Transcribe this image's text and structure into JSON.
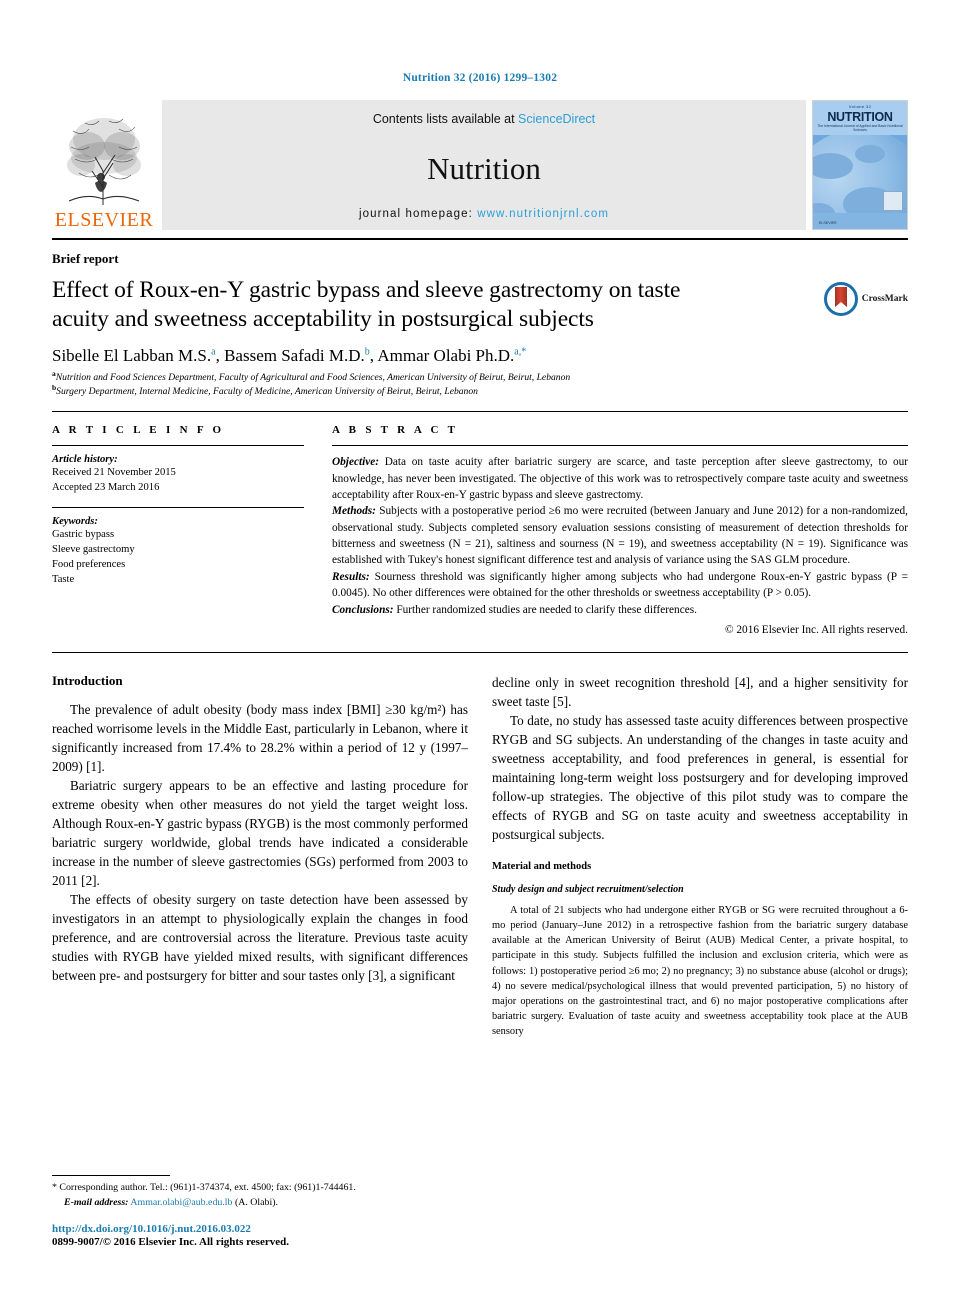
{
  "running_head": "Nutrition 32 (2016) 1299–1302",
  "masthead": {
    "contents_prefix": "Contents lists available at ",
    "sciencedirect": "ScienceDirect",
    "journal_name": "Nutrition",
    "homepage_prefix": "journal homepage: ",
    "homepage_url": "www.nutritionjrnl.com",
    "publisher": "ELSEVIER",
    "cover": {
      "volume_line": "Volume 32",
      "title": "NUTRITION",
      "subtitle": "The International Journal of Applied and Basic Nutritional Sciences",
      "publisher": "ELSEVIER"
    }
  },
  "article": {
    "kind": "Brief report",
    "title": "Effect of Roux-en-Y gastric bypass and sleeve gastrectomy on taste acuity and sweetness acceptability in postsurgical subjects",
    "crossmark_label": "CrossMark",
    "authors": [
      {
        "name": "Sibelle El Labban M.S.",
        "marks": "a",
        "sep": ", "
      },
      {
        "name": "Bassem Safadi M.D.",
        "marks": "b",
        "sep": ", "
      },
      {
        "name": "Ammar Olabi Ph.D.",
        "marks": "a,*",
        "sep": ""
      }
    ],
    "affiliations": [
      {
        "mark": "a",
        "text": "Nutrition and Food Sciences Department, Faculty of Agricultural and Food Sciences, American University of Beirut, Beirut, Lebanon"
      },
      {
        "mark": "b",
        "text": "Surgery Department, Internal Medicine, Faculty of Medicine, American University of Beirut, Beirut, Lebanon"
      }
    ]
  },
  "article_info": {
    "heading": "A R T I C L E  I N F O",
    "history_label": "Article history:",
    "history": [
      "Received 21 November 2015",
      "Accepted 23 March 2016"
    ],
    "keywords_label": "Keywords:",
    "keywords": [
      "Gastric bypass",
      "Sleeve gastrectomy",
      "Food preferences",
      "Taste"
    ]
  },
  "abstract": {
    "heading": "A B S T R A C T",
    "sections": [
      {
        "lead": "Objective:",
        "text": " Data on taste acuity after bariatric surgery are scarce, and taste perception after sleeve gastrectomy, to our knowledge, has never been investigated. The objective of this work was to retrospectively compare taste acuity and sweetness acceptability after Roux-en-Y gastric bypass and sleeve gastrectomy."
      },
      {
        "lead": "Methods:",
        "text": " Subjects with a postoperative period ≥6 mo were recruited (between January and June 2012) for a non-randomized, observational study. Subjects completed sensory evaluation sessions consisting of measurement of detection thresholds for bitterness and sweetness (N = 21), saltiness and sourness (N = 19), and sweetness acceptability (N = 19). Significance was established with Tukey's honest significant difference test and analysis of variance using the SAS GLM procedure."
      },
      {
        "lead": "Results:",
        "text": " Sourness threshold was significantly higher among subjects who had undergone Roux-en-Y gastric bypass (P = 0.0045). No other differences were obtained for the other thresholds or sweetness acceptability (P > 0.05)."
      },
      {
        "lead": "Conclusions:",
        "text": " Further randomized studies are needed to clarify these differences."
      }
    ],
    "copyright": "© 2016 Elsevier Inc. All rights reserved."
  },
  "body": {
    "left": {
      "heading": "Introduction",
      "paragraphs": [
        "The prevalence of adult obesity (body mass index [BMI] ≥30 kg/m²) has reached worrisome levels in the Middle East, particularly in Lebanon, where it significantly increased from 17.4% to 28.2% within a period of 12 y (1997–2009) [1].",
        "Bariatric surgery appears to be an effective and lasting procedure for extreme obesity when other measures do not yield the target weight loss. Although Roux-en-Y gastric bypass (RYGB) is the most commonly performed bariatric surgery worldwide, global trends have indicated a considerable increase in the number of sleeve gastrectomies (SGs) performed from 2003 to 2011 [2].",
        "The effects of obesity surgery on taste detection have been assessed by investigators in an attempt to physiologically explain the changes in food preference, and are controversial across the literature. Previous taste acuity studies with RYGB have yielded mixed results, with significant differences between pre- and postsurgery for bitter and sour tastes only [3], a significant"
      ]
    },
    "right": {
      "paragraphs": [
        "decline only in sweet recognition threshold [4], and a higher sensitivity for sweet taste [5].",
        "To date, no study has assessed taste acuity differences between prospective RYGB and SG subjects. An understanding of the changes in taste acuity and sweetness acceptability, and food preferences in general, is essential for maintaining long-term weight loss postsurgery and for developing improved follow-up strategies. The objective of this pilot study was to compare the effects of RYGB and SG on taste acuity and sweetness acceptability in postsurgical subjects."
      ],
      "heading": "Material and methods",
      "subheading": "Study design and subject recruitment/selection",
      "methods_paragraph": "A total of 21 subjects who had undergone either RYGB or SG were recruited throughout a 6-mo period (January–June 2012) in a retrospective fashion from the bariatric surgery database available at the American University of Beirut (AUB) Medical Center, a private hospital, to participate in this study. Subjects fulfilled the inclusion and exclusion criteria, which were as follows: 1) postoperative period ≥6 mo; 2) no pregnancy; 3) no substance abuse (alcohol or drugs); 4) no severe medical/psychological illness that would prevented participation, 5) no history of major operations on the gastrointestinal tract, and 6) no major postoperative complications after bariatric surgery. Evaluation of taste acuity and sweetness acceptability took place at the AUB sensory"
    }
  },
  "footnote": {
    "corresponding": "* Corresponding author. Tel.: (961)1-374374, ext. 4500; fax: (961)1-744461.",
    "email_label": "E-mail address:",
    "email": "Ammar.olabi@aub.edu.lb",
    "email_suffix": " (A. Olabi).",
    "doi": "http://dx.doi.org/10.1016/j.nut.2016.03.022",
    "issn": "0899-9007/© 2016 Elsevier Inc. All rights reserved."
  },
  "colors": {
    "link": "#1a7bb0",
    "sciencedirect": "#2a9fd6",
    "elsevier_orange": "#ec6608",
    "masthead_bg": "#e8e8e8"
  }
}
